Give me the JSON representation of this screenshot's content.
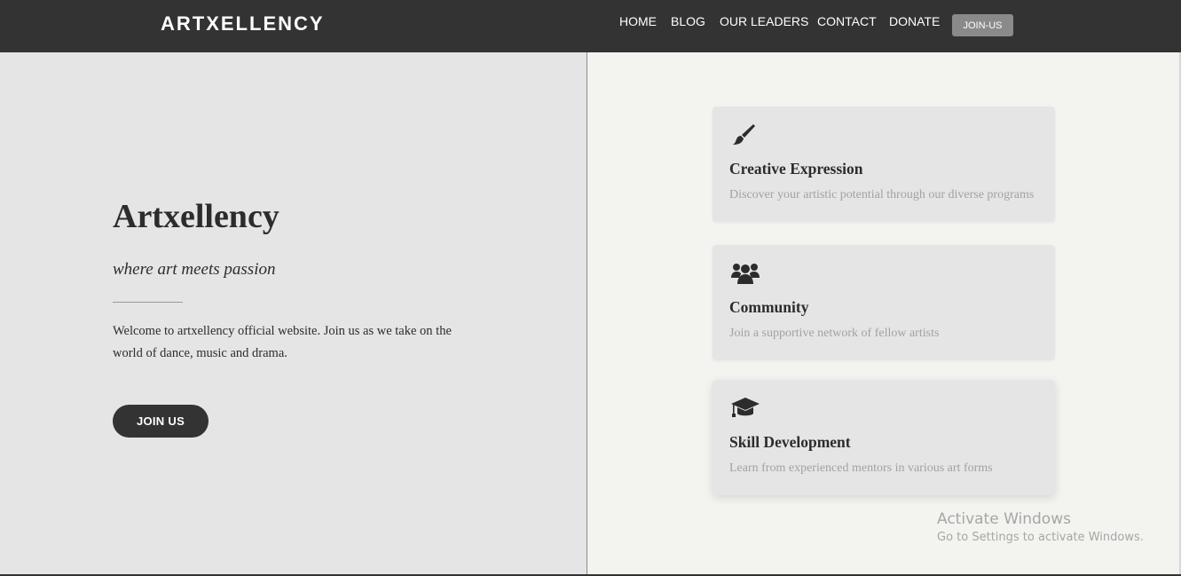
{
  "header": {
    "brand": "ARTXELLENCY",
    "nav": [
      "HOME",
      "BLOG",
      "OUR LEADERS",
      "CONTACT",
      "DONATE"
    ],
    "cta_label": "JOIN-US"
  },
  "hero": {
    "title": "Artxellency",
    "tagline": "where art meets passion",
    "description": "Welcome to artxellency official website. Join us as we take on the world of dance, music and drama.",
    "button_label": "JOIN US"
  },
  "features": [
    {
      "icon": "paintbrush-icon",
      "title": "Creative Expression",
      "description": "Discover your artistic potential through our diverse programs"
    },
    {
      "icon": "users-icon",
      "title": "Community",
      "description": "Join a supportive network of fellow artists"
    },
    {
      "icon": "graduation-cap-icon",
      "title": "Skill Development",
      "description": "Learn from experienced mentors in various art forms"
    }
  ],
  "watermark": {
    "title": "Activate Windows",
    "subtitle": "Go to Settings to activate Windows."
  },
  "colors": {
    "navbar": "#333333",
    "hero_bg": "#e5e5e5",
    "page_bg": "#f3f3ef",
    "nav_cta": "#8a8a8a",
    "muted_text": "#a2a2a2"
  }
}
